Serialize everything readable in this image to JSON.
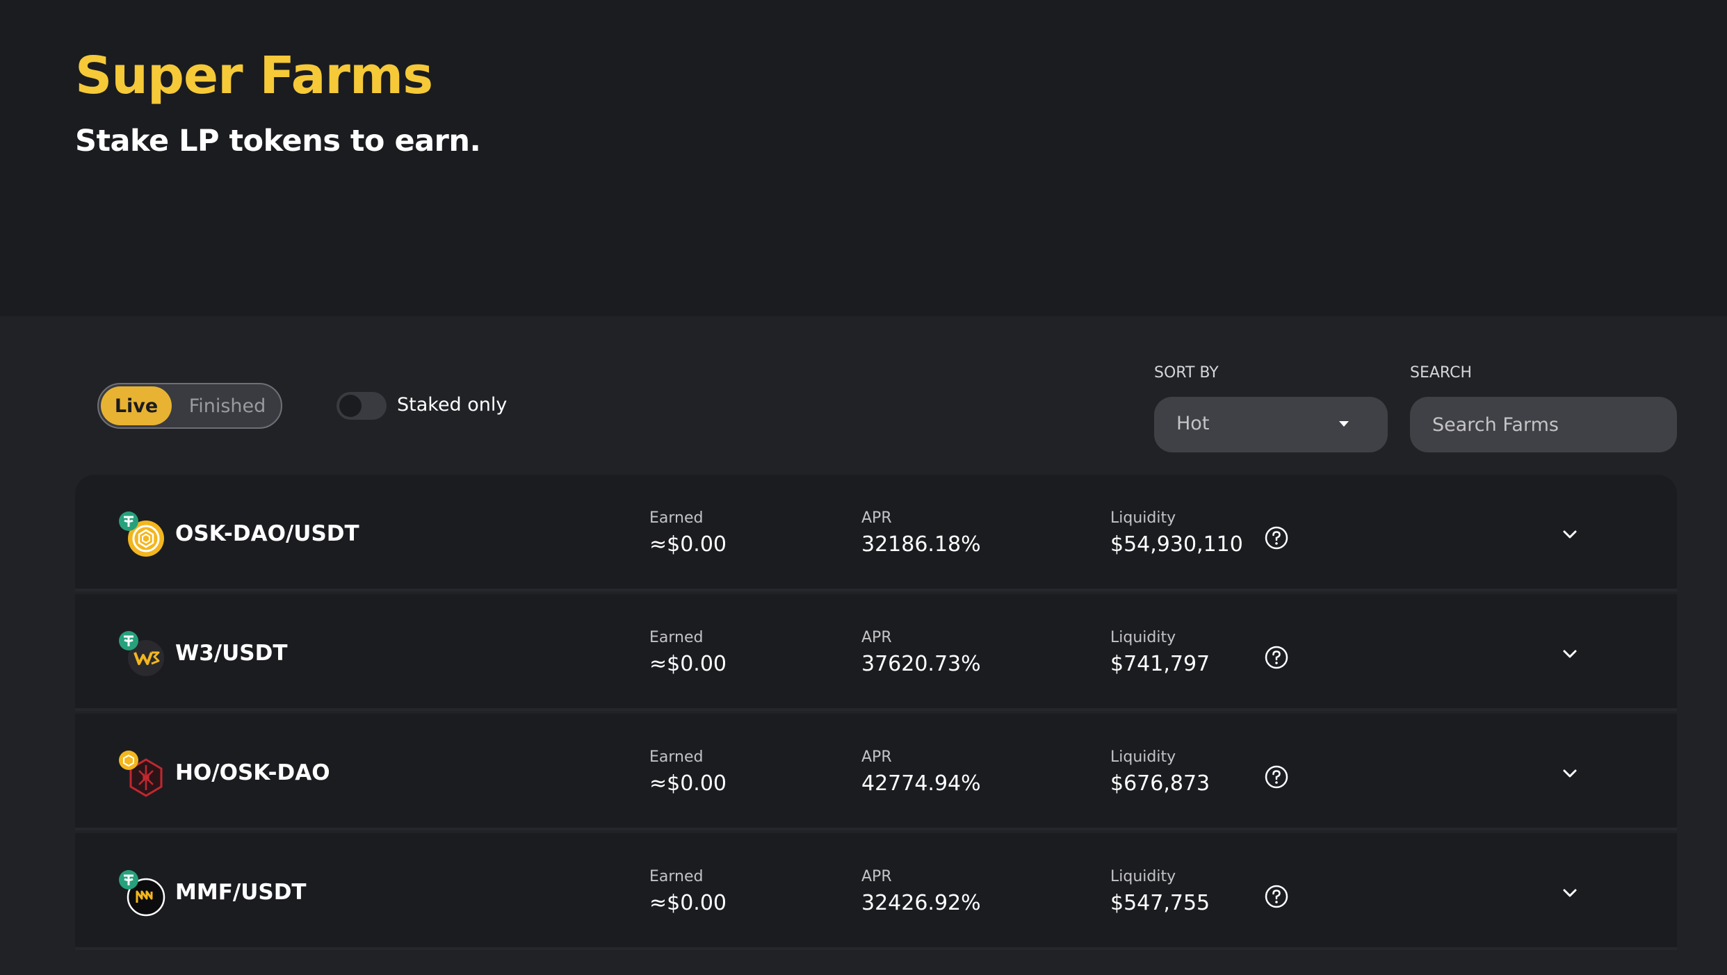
{
  "header": {
    "title": "Super Farms",
    "subtitle": "Stake LP tokens to earn."
  },
  "filters": {
    "live_label": "Live",
    "finished_label": "Finished",
    "active_tab": "Live",
    "staked_only_label": "Staked only",
    "staked_only_enabled": false,
    "sort_by_label": "SORT BY",
    "sort_value": "Hot",
    "search_label": "SEARCH",
    "search_placeholder": "Search Farms"
  },
  "colors": {
    "accent": "#f5c938",
    "toggle_active": "#e8b332",
    "page_bg": "#212226",
    "card_bg": "#1b1c20"
  },
  "farms": [
    {
      "pair": "OSK-DAO/USDT",
      "icons": [
        "tether-icon",
        "osk-dao-icon"
      ],
      "earned_label": "Earned",
      "earned": "≈$0.00",
      "apr_label": "APR",
      "apr": "32186.18%",
      "liquidity_label": "Liquidity",
      "liquidity": "$54,930,110"
    },
    {
      "pair": "W3/USDT",
      "icons": [
        "tether-icon",
        "w3-icon"
      ],
      "earned_label": "Earned",
      "earned": "≈$0.00",
      "apr_label": "APR",
      "apr": "37620.73%",
      "liquidity_label": "Liquidity",
      "liquidity": "$741,797"
    },
    {
      "pair": "HO/OSK-DAO",
      "icons": [
        "osk-dao-icon",
        "ho-icon"
      ],
      "earned_label": "Earned",
      "earned": "≈$0.00",
      "apr_label": "APR",
      "apr": "42774.94%",
      "liquidity_label": "Liquidity",
      "liquidity": "$676,873"
    },
    {
      "pair": "MMF/USDT",
      "icons": [
        "tether-icon",
        "mmf-icon"
      ],
      "earned_label": "Earned",
      "earned": "≈$0.00",
      "apr_label": "APR",
      "apr": "32426.92%",
      "liquidity_label": "Liquidity",
      "liquidity": "$547,755"
    }
  ]
}
